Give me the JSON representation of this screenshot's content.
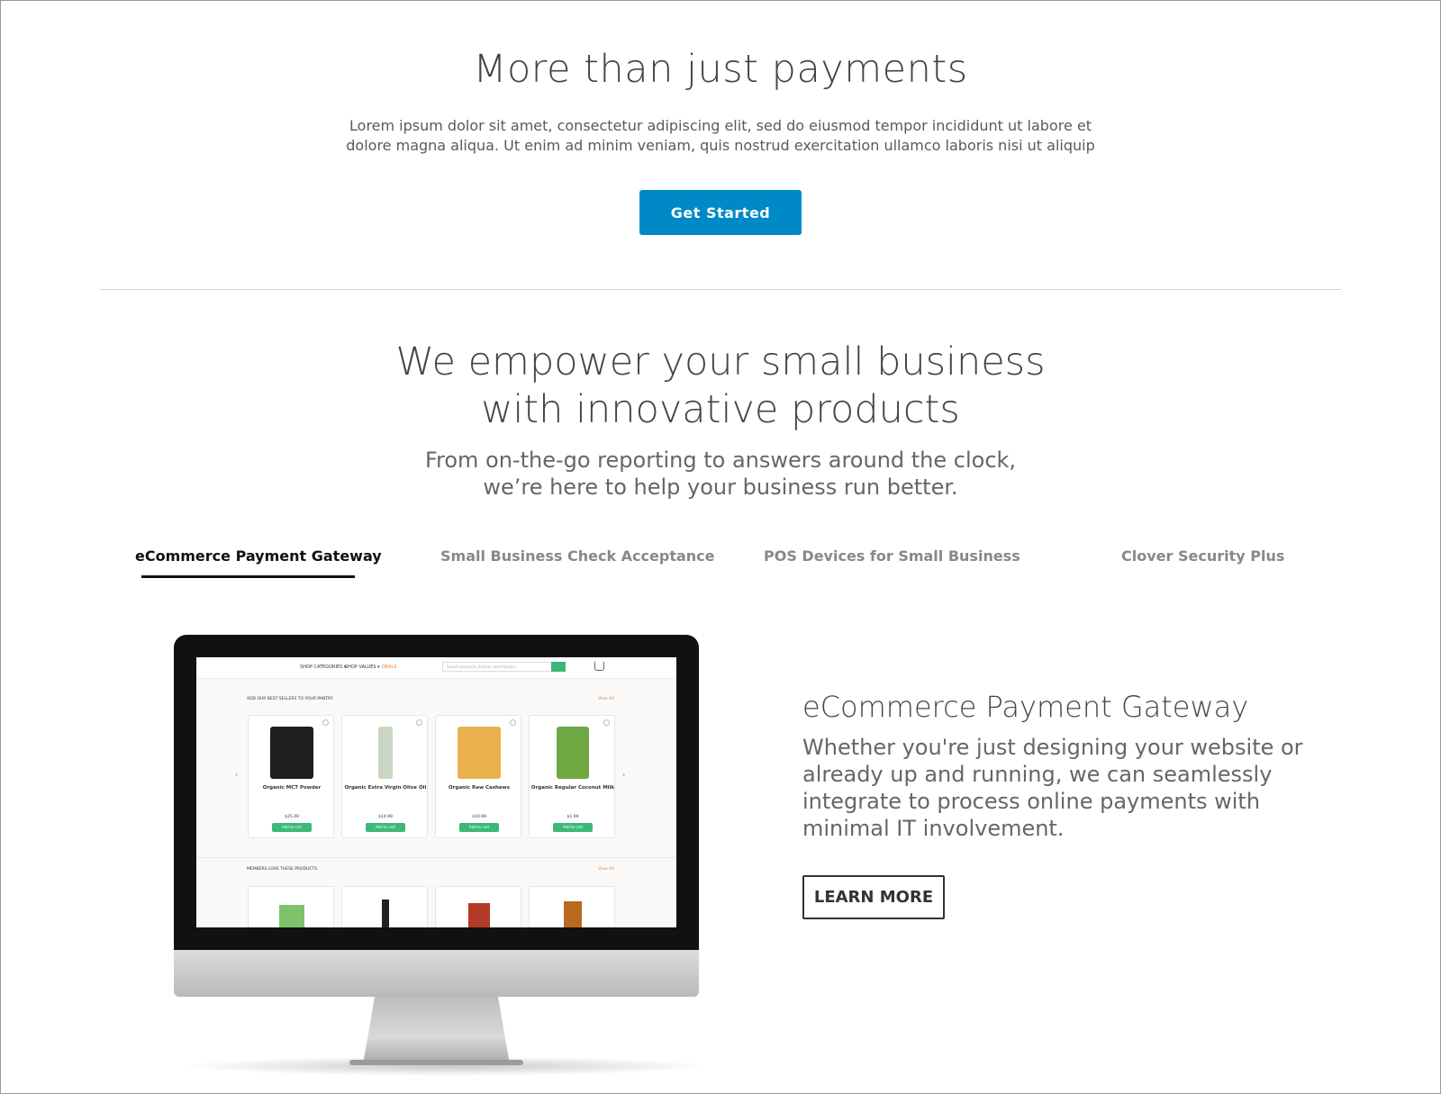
{
  "hero": {
    "title": "More than just payments",
    "text": "Lorem ipsum dolor sit amet, consectetur adipiscing elit, sed do eiusmod tempor incididunt ut labore et dolore magna aliqua. Ut enim ad minim veniam, quis nostrud exercitation ullamco laboris nisi ut aliquip ex",
    "cta_label": "Get Started"
  },
  "section": {
    "title_line1": "We empower your small business",
    "title_line2": "with innovative products",
    "subtitle_line1": "From on-the-go reporting to answers around the clock,",
    "subtitle_line2": "we’re here to help your business run better."
  },
  "tabs": [
    {
      "label": "eCommerce Payment Gateway",
      "active": true
    },
    {
      "label": "Small Business Check Acceptance",
      "active": false
    },
    {
      "label": "POS Devices for Small Business",
      "active": false
    },
    {
      "label": "Clover Security Plus",
      "active": false
    }
  ],
  "detail": {
    "title": "eCommerce Payment Gateway",
    "text": "Whether you're just designing your website or already up and running, we can seamlessly integrate to process online payments with minimal IT involvement.",
    "button_label": "LEARN MORE"
  },
  "mockup": {
    "nav": [
      "SHOP CATEGORIES ▾",
      "SHOP VALUES ▾",
      "DEALS"
    ],
    "search_placeholder": "Search products, brands, and lifestyle...",
    "section1_head": "ADD OUR BEST SELLERS TO YOUR PANTRY",
    "section1_link": "View All",
    "section2_head": "MEMBERS LOVE THESE PRODUCTS",
    "section2_link": "View All",
    "products": [
      {
        "name": "Organic MCT Powder",
        "price": "$25.49",
        "add": "Add to cart",
        "color": "#1e1e1e"
      },
      {
        "name": "Organic Extra Virgin Olive Oil",
        "price": "$14.99",
        "add": "Add to cart",
        "color": "#c9d6c4"
      },
      {
        "name": "Organic Raw Cashews",
        "price": "$10.99",
        "add": "Add to cart",
        "color": "#e9b24c"
      },
      {
        "name": "Organic Regular Coconut Milk",
        "price": "$1.99",
        "add": "Add to cart",
        "color": "#6fa843"
      }
    ]
  },
  "colors": {
    "primary": "#0089c7",
    "shop_green": "#3cb878",
    "deals": "#e8822a"
  }
}
